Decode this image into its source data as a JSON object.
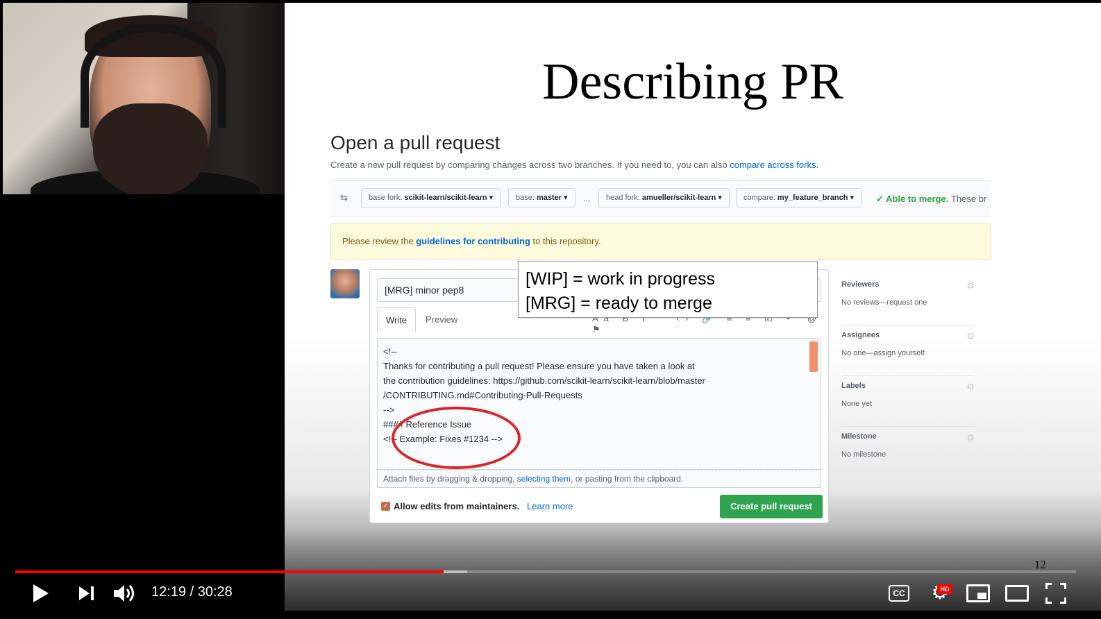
{
  "video": {
    "current_time": "12:19",
    "duration": "30:28",
    "time_display": "12:19 / 30:28",
    "progress_fraction": 0.404,
    "buffered_fraction": 0.426,
    "colors": {
      "progress": "#ff0000",
      "hd_badge": "#ff0000"
    }
  },
  "controls": {
    "play_icon": "play-icon",
    "next_icon": "next-icon",
    "volume_icon": "volume-icon",
    "cc_label": "CC",
    "settings_icon": "gear-icon",
    "hd_label": "HD",
    "miniplayer_icon": "miniplayer-icon",
    "theater_icon": "theater-icon",
    "fullscreen_icon": "fullscreen-icon"
  },
  "slide": {
    "title": "Describing PR",
    "page_number": "12",
    "callout": {
      "line1": "[WIP] = work in progress",
      "line2": "[MRG] = ready to merge"
    },
    "github": {
      "heading": "Open a pull request",
      "subtitle_text": "Create a new pull request by comparing changes across two branches. If you need to, you can also ",
      "subtitle_link": "compare across forks.",
      "branches": {
        "base_fork_key": "base fork:",
        "base_fork_val": "scikit-learn/scikit-learn",
        "base_key": "base:",
        "base_val": "master",
        "ellipsis": "...",
        "head_fork_key": "head fork:",
        "head_fork_val": "amueller/scikit-learn",
        "compare_key": "compare:",
        "compare_val": "my_feature_branch",
        "merge_status": "Able to merge.",
        "merge_rest": "These br"
      },
      "notice": {
        "pre": "Please review the ",
        "link": "guidelines for contributing",
        "post": " to this repository."
      },
      "pr_title": "[MRG] minor pep8",
      "tabs": {
        "write": "Write",
        "preview": "Preview"
      },
      "editor_lines": [
        "<!--",
        "Thanks for contributing a pull request! Please ensure you have taken a look at",
        "the contribution guidelines: https://github.com/scikit-learn/scikit-learn/blob/master",
        "/CONTRIBUTING.md#Contributing-Pull-Requests",
        "-->",
        "#### Reference Issue",
        "<!-- Example: Fixes #1234 -->"
      ],
      "attach": {
        "pre": "Attach files by dragging & dropping, ",
        "link": "selecting them",
        "post": ", or pasting from the clipboard."
      },
      "allow_edits": "Allow edits from maintainers.",
      "learn_more": "Learn more",
      "create_button": "Create pull request",
      "sidebar": [
        {
          "heading": "Reviewers",
          "value": "No reviews—request one"
        },
        {
          "heading": "Assignees",
          "value": "No one—assign yourself"
        },
        {
          "heading": "Labels",
          "value": "None yet"
        },
        {
          "heading": "Milestone",
          "value": "No milestone"
        }
      ],
      "colors": {
        "link": "#0366d6",
        "merge_ok": "#28a745",
        "button": "#2ea44f",
        "annotation_circle": "#d9252a"
      }
    }
  }
}
